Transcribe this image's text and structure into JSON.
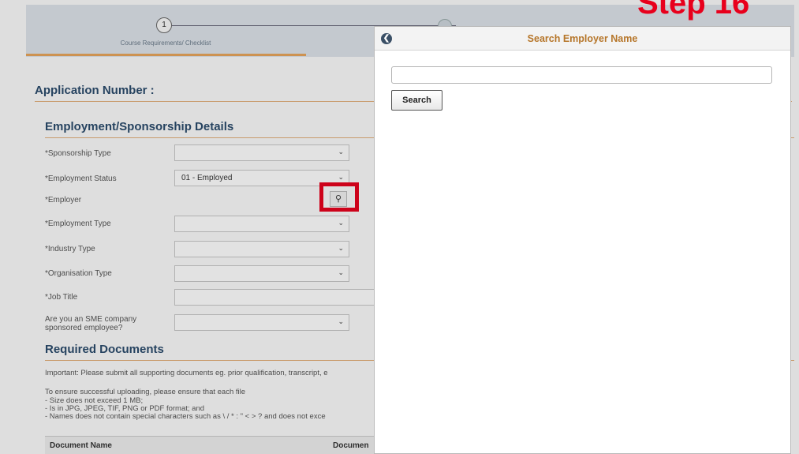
{
  "step_label": "Step 16",
  "progress": {
    "step_number": "1",
    "step_label": "Course Requirements/ Checklist"
  },
  "application_number_label": "Application Number :",
  "employment_section": {
    "title": "Employment/Sponsorship Details",
    "fields": {
      "sponsorship_type": {
        "label": "*Sponsorship Type",
        "value": ""
      },
      "employment_status": {
        "label": "*Employment Status",
        "value": "01 - Employed"
      },
      "employer": {
        "label": "*Employer"
      },
      "employment_type": {
        "label": "*Employment Type",
        "value": ""
      },
      "industry_type": {
        "label": "*Industry Type",
        "value": ""
      },
      "organisation_type": {
        "label": "*Organisation Type",
        "value": ""
      },
      "job_title": {
        "label": "*Job Title",
        "value": ""
      },
      "sme_sponsored": {
        "label_line1": "Are you an SME company",
        "label_line2": "sponsored employee?",
        "value": ""
      }
    }
  },
  "documents_section": {
    "title": "Required Documents",
    "important_note": "Important: Please submit all supporting documents eg. prior qualification, transcript, e",
    "upload_intro": "To ensure successful uploading, please ensure that each file",
    "rules": [
      "- Size does not exceed 1 MB;",
      "- Is in JPG, JPEG, TIF, PNG or PDF format; and",
      "- Names does not contain special characters such as \\ / * : \" < > ? and does not exce"
    ],
    "table_headers": [
      "Document Name",
      "Documen"
    ]
  },
  "modal": {
    "title": "Search Employer Name",
    "back_icon": "back-circle-icon",
    "search_input_value": "",
    "search_button": "Search"
  },
  "icons": {
    "lookup": "magnifier-icon",
    "dropdown": "chevron-down-icon"
  },
  "colors": {
    "highlight": "#e8001c",
    "modal_title": "#b6762a",
    "section_title": "#2a4a6b"
  }
}
